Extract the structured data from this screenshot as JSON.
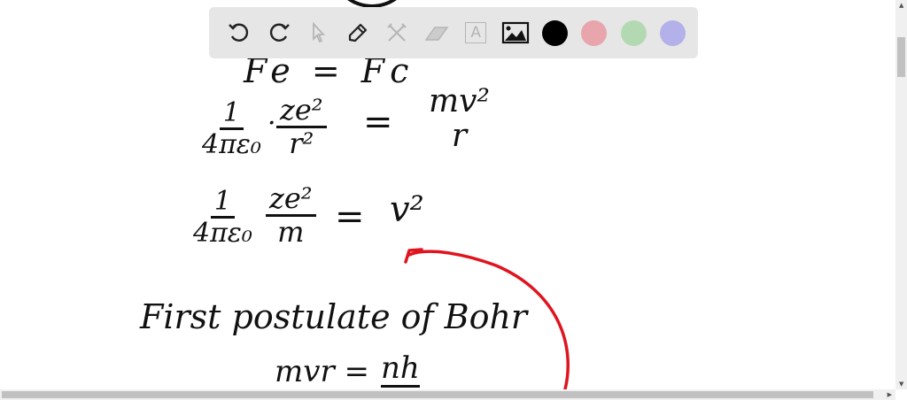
{
  "toolbar": {
    "tools": [
      {
        "name": "undo-icon",
        "enabled": true
      },
      {
        "name": "redo-icon",
        "enabled": true
      },
      {
        "name": "select-cursor-icon",
        "enabled": false
      },
      {
        "name": "pen-icon",
        "enabled": true
      },
      {
        "name": "tools-icon",
        "enabled": false
      },
      {
        "name": "eraser-icon",
        "enabled": false
      },
      {
        "name": "text-icon",
        "enabled": false
      },
      {
        "name": "image-icon",
        "enabled": true
      }
    ],
    "text_tool_glyph": "A",
    "colors": [
      "#000000",
      "#e8a5ab",
      "#b3d9b3",
      "#b3b0ea"
    ]
  },
  "canvas": {
    "line1": "Fe = Fc",
    "line2": {
      "f1_num": "1",
      "f1_den": "4πε₀",
      "dot": "·",
      "f2_num": "ze²",
      "f2_den": "r²",
      "eq": "=",
      "f3_num": "mv²",
      "f3_den": "r"
    },
    "line3": {
      "f1_num": "1",
      "f1_den": "4πε₀",
      "f2_num": "ze²",
      "f2_den": "m",
      "eq": "=",
      "rhs": "v²"
    },
    "heading": "First postulate of Bohr",
    "line4": {
      "lhs": "mvr =",
      "num": "nh"
    },
    "arrow_color": "#e0141e"
  }
}
